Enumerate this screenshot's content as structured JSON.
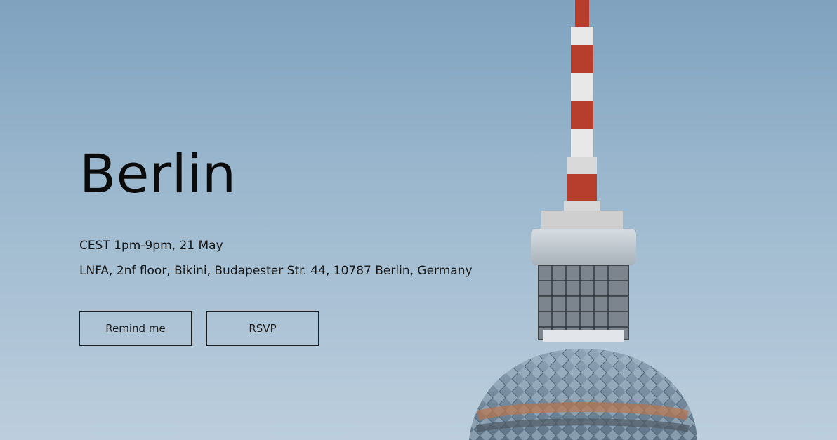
{
  "event": {
    "city": "Berlin",
    "time": "CEST 1pm-9pm, 21 May",
    "location": "LNFA, 2nf floor, Bikini, Budapester Str. 44, 10787 Berlin, Germany"
  },
  "actions": {
    "remind_label": "Remind me",
    "rsvp_label": "RSVP"
  }
}
